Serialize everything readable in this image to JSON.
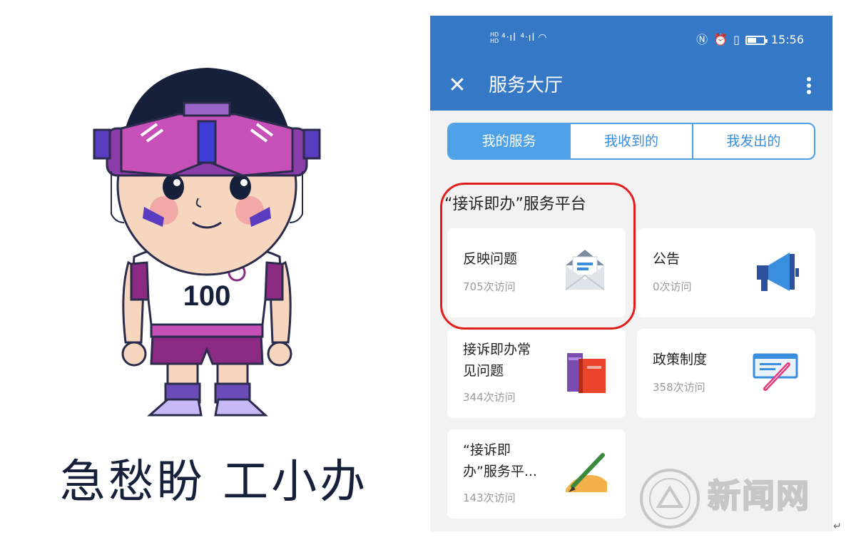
{
  "slogan": "急愁盼  工小办",
  "mascot": {
    "jersey_number": "100"
  },
  "status_bar": {
    "time": "15:56",
    "hd": "HD"
  },
  "header": {
    "title": "服务大厅"
  },
  "tabs": [
    {
      "label": "我的服务",
      "active": true
    },
    {
      "label": "我收到的",
      "active": false
    },
    {
      "label": "我发出的",
      "active": false
    }
  ],
  "section": {
    "title": "“接诉即办”服务平台"
  },
  "cards": [
    {
      "title": "反映问题",
      "visits": "705次访问",
      "icon": "envelope-icon"
    },
    {
      "title": "公告",
      "visits": "0次访问",
      "icon": "megaphone-icon"
    },
    {
      "title_line1": "接诉即办常",
      "title_line2": "见问题",
      "visits": "344次访问",
      "icon": "books-icon"
    },
    {
      "title": "政策制度",
      "visits": "358次访问",
      "icon": "document-pen-icon"
    },
    {
      "title_line1": "“接诉即",
      "title_line2": "办”服务平...",
      "visits": "143次访问",
      "icon": "writing-hand-icon"
    }
  ],
  "watermark": {
    "text": "新闻网"
  },
  "colors": {
    "header_blue": "#3478c6",
    "tab_blue": "#4ea1e6",
    "highlight_red": "#e21d1d",
    "page_bg": "#f2f2f2"
  }
}
